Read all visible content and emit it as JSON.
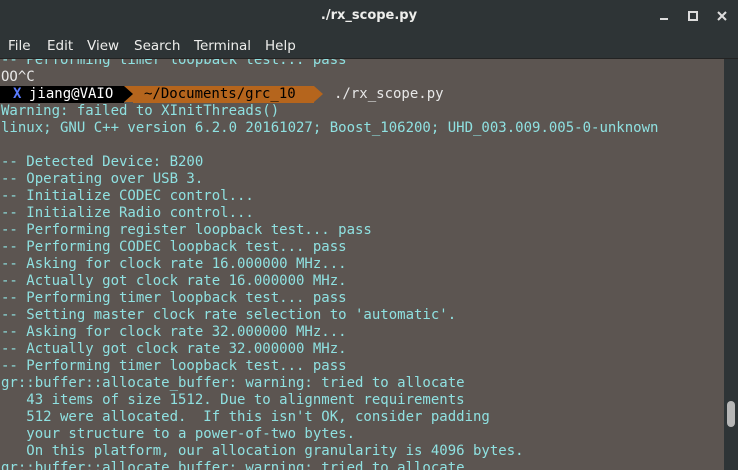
{
  "window": {
    "title": "./rx_scope.py",
    "buttons": [
      "minimize",
      "maximize",
      "close"
    ]
  },
  "menu": {
    "items": [
      "File",
      "Edit",
      "View",
      "Search",
      "Terminal",
      "Help"
    ]
  },
  "terminal": {
    "top_partial": "-- Performing timer loopback test... pass",
    "interrupt": "OO^C",
    "prompt": {
      "user": "jiang@VAIO",
      "directory": "~/Documents/grc_10",
      "command": "./rx_scope.py",
      "logo_mark": "X"
    },
    "lines": [
      "Warning: failed to XInitThreads()",
      "linux; GNU C++ version 6.2.0 20161027; Boost_106200; UHD_003.009.005-0-unknown",
      "",
      "-- Detected Device: B200",
      "-- Operating over USB 3.",
      "-- Initialize CODEC control...",
      "-- Initialize Radio control...",
      "-- Performing register loopback test... pass",
      "-- Performing CODEC loopback test... pass",
      "-- Asking for clock rate 16.000000 MHz...",
      "-- Actually got clock rate 16.000000 MHz.",
      "-- Performing timer loopback test... pass",
      "-- Setting master clock rate selection to 'automatic'.",
      "-- Asking for clock rate 32.000000 MHz...",
      "-- Actually got clock rate 32.000000 MHz.",
      "-- Performing timer loopback test... pass",
      "gr::buffer::allocate_buffer: warning: tried to allocate",
      "   43 items of size 1512. Due to alignment requirements",
      "   512 were allocated.  If this isn't OK, consider padding",
      "   your structure to a power-of-two bytes.",
      "   On this platform, our allocation granularity is 4096 bytes.",
      "gr::buffer::allocate_buffer: warning: tried to allocate"
    ]
  },
  "colors": {
    "background": "#5c5551",
    "output_text": "#8fe1e1",
    "chrome": "#2e3436",
    "prompt_user_bg": "#000000",
    "prompt_dir_bg": "#b5651d"
  }
}
